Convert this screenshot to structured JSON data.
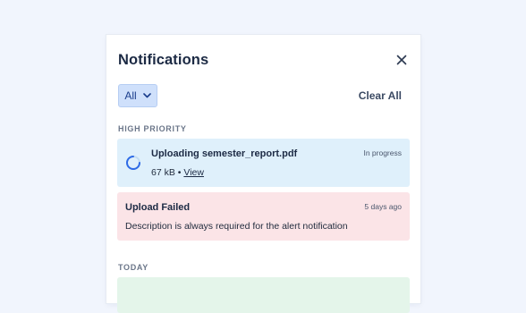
{
  "panel": {
    "title": "Notifications",
    "close_icon": "close-icon"
  },
  "toolbar": {
    "filter_label": "All",
    "filter_icon": "chevron-down-icon",
    "clear_all_label": "Clear All"
  },
  "sections": {
    "high_priority": "HIGH PRIORITY",
    "today": "TODAY"
  },
  "notifications": {
    "upload": {
      "title": "Uploading semester_report.pdf",
      "status": "In progress",
      "size": "67 kB",
      "separator": "•",
      "link": "View",
      "icon": "spinner-icon"
    },
    "failed": {
      "title": "Upload Failed",
      "time": "5 days ago",
      "message": "Description is always required for the alert notification"
    }
  },
  "colors": {
    "accent": "#2e6be6",
    "progress_bg": "#dff0fb",
    "error_bg": "#fbe4e7",
    "success_bg": "#e4f5ea",
    "filter_bg": "#cfe0fb"
  }
}
